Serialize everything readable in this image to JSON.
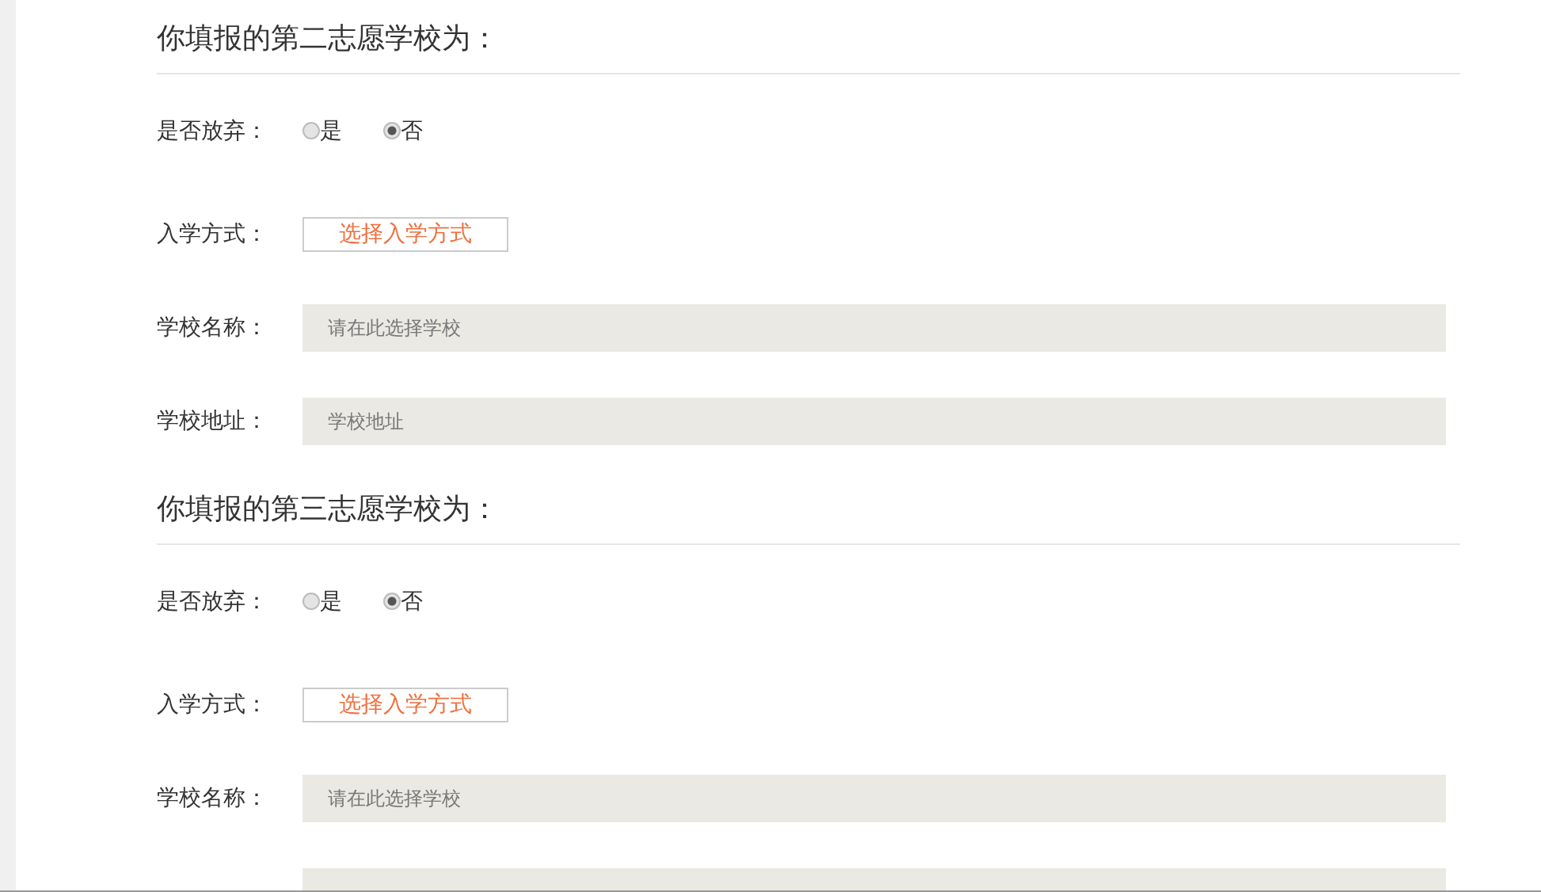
{
  "sections": [
    {
      "title": "你填报的第二志愿学校为：",
      "rows": [
        {
          "kind": "radio",
          "label": "是否放弃：",
          "options": [
            {
              "label": "是",
              "selected": false
            },
            {
              "label": "否",
              "selected": true
            }
          ]
        },
        {
          "kind": "button",
          "label": "入学方式：",
          "button": "选择入学方式"
        },
        {
          "kind": "field",
          "label": "学校名称：",
          "placeholder": "请在此选择学校"
        },
        {
          "kind": "field",
          "label": "学校地址：",
          "placeholder": "学校地址"
        }
      ]
    },
    {
      "title": "你填报的第三志愿学校为：",
      "rows": [
        {
          "kind": "radio",
          "label": "是否放弃：",
          "options": [
            {
              "label": "是",
              "selected": false
            },
            {
              "label": "否",
              "selected": true
            }
          ]
        },
        {
          "kind": "button",
          "label": "入学方式：",
          "button": "选择入学方式"
        },
        {
          "kind": "field",
          "label": "学校名称：",
          "placeholder": "请在此选择学校"
        },
        {
          "kind": "field"
        }
      ]
    }
  ]
}
